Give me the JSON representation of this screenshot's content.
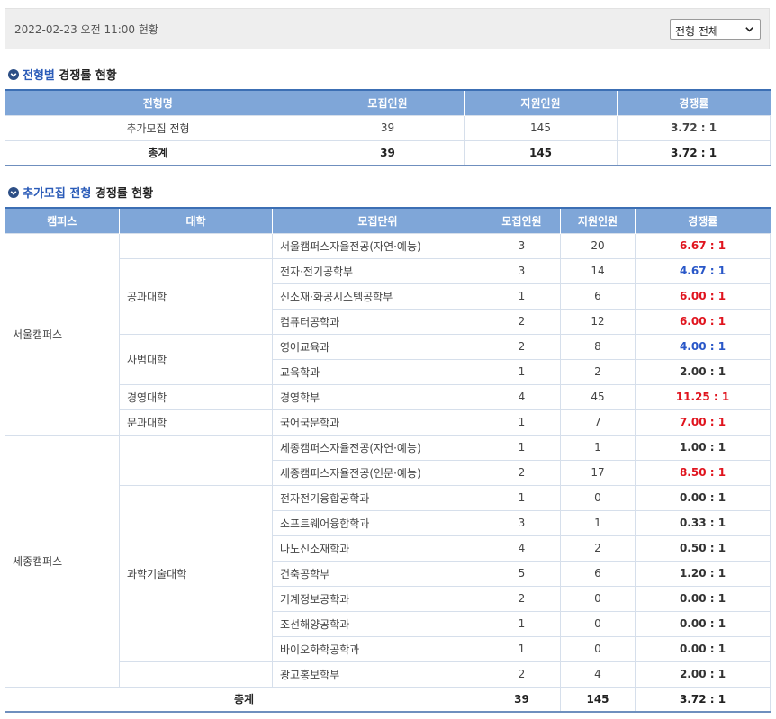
{
  "header": {
    "status_text": "2022-02-23 오전 11:00 현황",
    "filter": {
      "selected": "전형 전체"
    }
  },
  "section1": {
    "title_prefix": "전형별",
    "title_rest": " 경쟁률 현황",
    "columns": [
      "전형명",
      "모집인원",
      "지원인원",
      "경쟁률"
    ],
    "rows": [
      {
        "name": "추가모집 전형",
        "quota": "39",
        "applicants": "145",
        "ratio": "3.72 : 1"
      }
    ],
    "total": {
      "label": "총계",
      "quota": "39",
      "applicants": "145",
      "ratio": "3.72 : 1"
    }
  },
  "section2": {
    "title_prefix": "추가모집 전형",
    "title_rest": " 경쟁률 현황",
    "columns": [
      "캠퍼스",
      "대학",
      "모집단위",
      "모집인원",
      "지원인원",
      "경쟁률"
    ],
    "campuses": [
      "서울캠퍼스",
      "세종캠퍼스"
    ],
    "colleges": [
      "",
      "공과대학",
      "사범대학",
      "경영대학",
      "문과대학",
      "",
      "과학기술대학",
      ""
    ],
    "rows": [
      {
        "unit": "서울캠퍼스자율전공(자연·예능)",
        "quota": "3",
        "applicants": "20",
        "ratio": "6.67 : 1",
        "color": "#e0141e"
      },
      {
        "unit": "전자·전기공학부",
        "quota": "3",
        "applicants": "14",
        "ratio": "4.67 : 1",
        "color": "#2957c8"
      },
      {
        "unit": "신소재·화공시스템공학부",
        "quota": "1",
        "applicants": "6",
        "ratio": "6.00 : 1",
        "color": "#e0141e"
      },
      {
        "unit": "컴퓨터공학과",
        "quota": "2",
        "applicants": "12",
        "ratio": "6.00 : 1",
        "color": "#e0141e"
      },
      {
        "unit": "영어교육과",
        "quota": "2",
        "applicants": "8",
        "ratio": "4.00 : 1",
        "color": "#2957c8"
      },
      {
        "unit": "교육학과",
        "quota": "1",
        "applicants": "2",
        "ratio": "2.00 : 1",
        "color": "#333333"
      },
      {
        "unit": "경영학부",
        "quota": "4",
        "applicants": "45",
        "ratio": "11.25 : 1",
        "color": "#e0141e"
      },
      {
        "unit": "국어국문학과",
        "quota": "1",
        "applicants": "7",
        "ratio": "7.00 : 1",
        "color": "#e0141e"
      },
      {
        "unit": "세종캠퍼스자율전공(자연·예능)",
        "quota": "1",
        "applicants": "1",
        "ratio": "1.00 : 1",
        "color": "#333333"
      },
      {
        "unit": "세종캠퍼스자율전공(인문·예능)",
        "quota": "2",
        "applicants": "17",
        "ratio": "8.50 : 1",
        "color": "#e0141e"
      },
      {
        "unit": "전자전기융합공학과",
        "quota": "1",
        "applicants": "0",
        "ratio": "0.00 : 1",
        "color": "#333333"
      },
      {
        "unit": "소프트웨어융합학과",
        "quota": "3",
        "applicants": "1",
        "ratio": "0.33 : 1",
        "color": "#333333"
      },
      {
        "unit": "나노신소재학과",
        "quota": "4",
        "applicants": "2",
        "ratio": "0.50 : 1",
        "color": "#333333"
      },
      {
        "unit": "건축공학부",
        "quota": "5",
        "applicants": "6",
        "ratio": "1.20 : 1",
        "color": "#333333"
      },
      {
        "unit": "기계정보공학과",
        "quota": "2",
        "applicants": "0",
        "ratio": "0.00 : 1",
        "color": "#333333"
      },
      {
        "unit": "조선해양공학과",
        "quota": "1",
        "applicants": "0",
        "ratio": "0.00 : 1",
        "color": "#333333"
      },
      {
        "unit": "바이오화학공학과",
        "quota": "1",
        "applicants": "0",
        "ratio": "0.00 : 1",
        "color": "#333333"
      },
      {
        "unit": "광고홍보학부",
        "quota": "2",
        "applicants": "4",
        "ratio": "2.00 : 1",
        "color": "#333333"
      }
    ],
    "total": {
      "label": "총계",
      "quota": "39",
      "applicants": "145",
      "ratio": "3.72 : 1"
    }
  },
  "icons": {
    "section": "check-circle-icon",
    "dropdown": "chevron-down-icon"
  },
  "colors": {
    "header_bg": "#7fa6d8",
    "accent": "#2a5bb8",
    "high": "#e0141e",
    "mid": "#2957c8"
  }
}
